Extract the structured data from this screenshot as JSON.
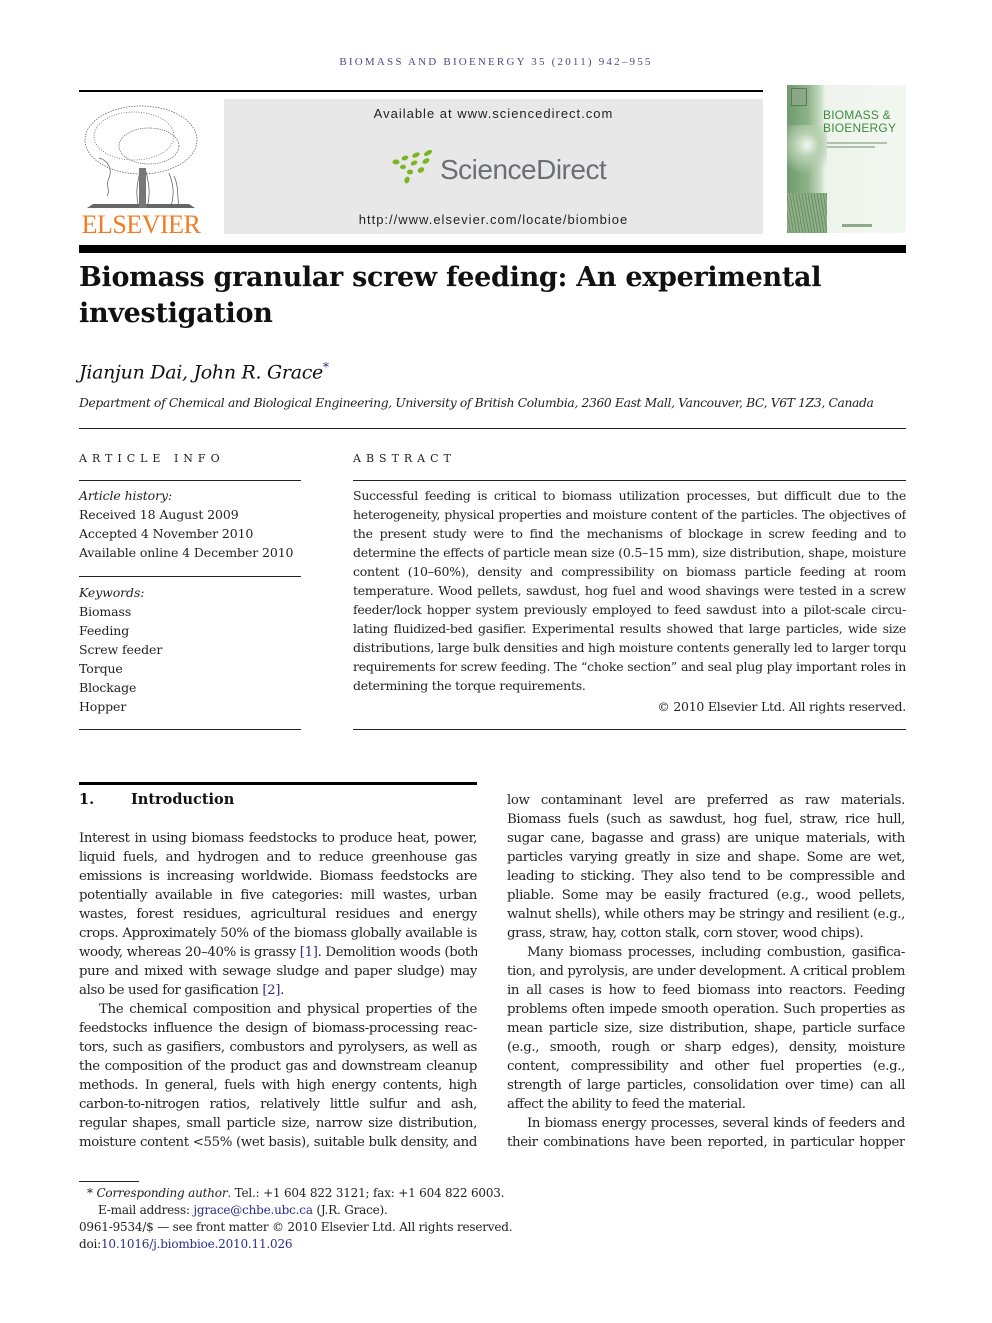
{
  "journal_header": {
    "running_head": "BIOMASS AND BIOENERGY 35 (2011) 942–955",
    "publisher_logo_text": "ELSEVIER",
    "sciencedirect_available": "Available at www.sciencedirect.com",
    "sciencedirect_logo_text": "ScienceDirect",
    "journal_url": "http://www.elsevier.com/locate/biombioe",
    "cover_title_line1": "BIOMASS &",
    "cover_title_line2": "BIOENERGY",
    "colors": {
      "elsevier_orange": "#f47b20",
      "sciencedirect_green": "#7ab51d",
      "link_blue": "#2b2f87",
      "cover_green": "#3f8a3f"
    }
  },
  "article": {
    "title_line1": "Biomass granular screw feeding: An experimental",
    "title_line2": "investigation",
    "authors": "Jianjun Dai, John R. Grace",
    "corresponding_mark": "*",
    "affiliation": "Department of Chemical and Biological Engineering, University of British Columbia, 2360 East Mall, Vancouver, BC, V6T 1Z3, Canada"
  },
  "article_info": {
    "heading": "ARTICLE INFO",
    "history_label": "Article history:",
    "history": [
      "Received 18 August 2009",
      "Accepted 4 November 2010",
      "Available online 4 December 2010"
    ],
    "keywords_label": "Keywords:",
    "keywords": [
      "Biomass",
      "Feeding",
      "Screw feeder",
      "Torque",
      "Blockage",
      "Hopper"
    ]
  },
  "abstract": {
    "heading": "ABSTRACT",
    "lines": [
      "Successful feeding is critical to biomass utilization processes, but difficult due to the",
      "heterogeneity, physical properties and moisture content of the particles. The objectives of",
      "the present study were to find the mechanisms of blockage in screw feeding and to",
      "determine the effects of particle mean size (0.5–15 mm), size distribution, shape, moisture",
      "content (10–60%), density and compressibility on biomass particle feeding at room",
      "temperature. Wood pellets, sawdust, hog fuel and wood shavings were tested in a screw",
      "feeder/lock hopper system previously employed to feed sawdust into a pilot-scale circu-",
      "lating fluidized-bed gasifier. Experimental results showed that large particles, wide size",
      "distributions, large bulk densities and high moisture contents generally led to larger torque",
      "requirements for screw feeding. The “choke section” and seal plug play important roles in",
      "determining the torque requirements."
    ],
    "copyright": "© 2010 Elsevier Ltd. All rights reserved."
  },
  "introduction": {
    "number": "1.",
    "heading": "Introduction",
    "left_column": [
      {
        "t": "Interest in using biomass feedstocks to produce heat, power,"
      },
      {
        "t": "liquid fuels, and hydrogen and to reduce greenhouse gas"
      },
      {
        "t": "emissions is increasing worldwide. Biomass feedstocks are"
      },
      {
        "t": "potentially available in five categories: mill wastes, urban"
      },
      {
        "t": "wastes, forest residues, agricultural residues and energy"
      },
      {
        "t": "crops. Approximately 50% of the biomass globally available is"
      },
      {
        "t": "woody, whereas 20–40% is grassy ",
        "ref": "[1]",
        "after": ". Demolition woods (both"
      },
      {
        "t": "pure and mixed with sewage sludge and paper sludge) may"
      },
      {
        "t": "also be used for gasification ",
        "ref": "[2]",
        "after": ".",
        "last": true
      },
      {
        "t": "The chemical composition and physical properties of the",
        "indent": true
      },
      {
        "t": "feedstocks influence the design of biomass-processing reac-"
      },
      {
        "t": "tors, such as gasifiers, combustors and pyrolysers, as well as"
      },
      {
        "t": "the composition of the product gas and downstream cleanup"
      },
      {
        "t": "methods. In general, fuels with high energy contents, high"
      },
      {
        "t": "carbon-to-nitrogen ratios, relatively little sulfur and ash,"
      },
      {
        "t": "regular shapes, small particle size, narrow size distribution,"
      },
      {
        "t": "moisture content <55% (wet basis), suitable bulk density, and"
      }
    ],
    "right_column": [
      {
        "t": "low contaminant level are preferred as raw materials."
      },
      {
        "t": "Biomass fuels (such as sawdust, hog fuel, straw, rice hull,"
      },
      {
        "t": "sugar cane, bagasse and grass) are unique materials, with"
      },
      {
        "t": "particles varying greatly in size and shape. Some are wet,"
      },
      {
        "t": "leading to sticking. They also tend to be compressible and"
      },
      {
        "t": "pliable. Some may be easily fractured (e.g., wood pellets,"
      },
      {
        "t": "walnut shells), while others may be stringy and resilient (e.g.,"
      },
      {
        "t": "grass, straw, hay, cotton stalk, corn stover, wood chips).",
        "last": true
      },
      {
        "t": "Many biomass processes, including combustion, gasifica-",
        "indent": true
      },
      {
        "t": "tion, and pyrolysis, are under development. A critical problem"
      },
      {
        "t": "in all cases is how to feed biomass into reactors. Feeding"
      },
      {
        "t": "problems often impede smooth operation. Such properties as"
      },
      {
        "t": "mean particle size, size distribution, shape, particle surface"
      },
      {
        "t": "(e.g., smooth, rough or sharp edges), density, moisture"
      },
      {
        "t": "content, compressibility and other fuel properties (e.g.,"
      },
      {
        "t": "strength of large particles, consolidation over time) can all"
      },
      {
        "t": "affect the ability to feed the material.",
        "last": true
      },
      {
        "t": "In biomass energy processes, several kinds of feeders and",
        "indent": true
      },
      {
        "t": "their combinations have been reported, in particular hopper"
      }
    ]
  },
  "footnotes": {
    "corr_mark": "*",
    "corr_label": "Corresponding author",
    "corr_contact": ". Tel.: +1 604 822 3121; fax: +1 604 822 6003.",
    "email_label": "E-mail address: ",
    "email": "jgrace@chbe.ubc.ca",
    "email_owner": " (J.R. Grace).",
    "front_matter": "0961-9534/$ — see front matter © 2010 Elsevier Ltd. All rights reserved.",
    "doi_label": "doi:",
    "doi": "10.1016/j.biombioe.2010.11.026"
  }
}
